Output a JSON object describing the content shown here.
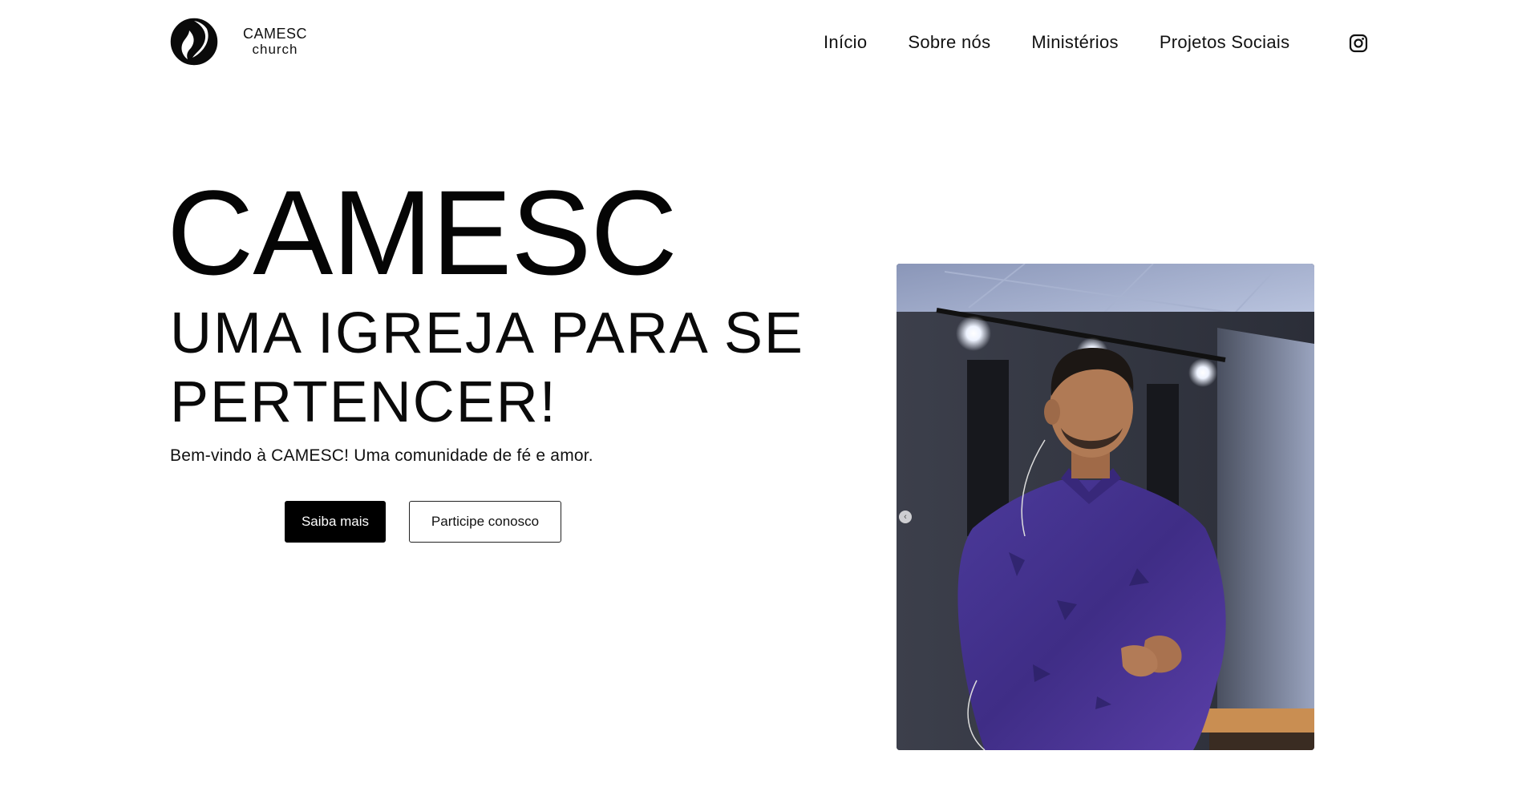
{
  "brand": {
    "name": "CAMESC",
    "sub": "church",
    "logo_icon": "camesc-logo-icon"
  },
  "nav": {
    "items": [
      {
        "label": "Início"
      },
      {
        "label": "Sobre nós"
      },
      {
        "label": "Ministérios"
      },
      {
        "label": "Projetos Sociais"
      }
    ],
    "social_icon": "instagram-icon"
  },
  "hero": {
    "title": "CAMESC",
    "subtitle": "UMA IGREJA PARA SE PERTENCER!",
    "description": "Bem-vindo à CAMESC! Uma comunidade de fé e amor.",
    "primary_button": "Saiba mais",
    "secondary_button": "Participe conosco",
    "image": {
      "icon": "pastor-photo",
      "prev_icon": "chevron-left-icon",
      "prev_glyph": "‹"
    }
  },
  "colors": {
    "background": "#ffffff",
    "text": "#111111",
    "primary_button_bg": "#000000",
    "primary_button_text": "#ffffff"
  }
}
